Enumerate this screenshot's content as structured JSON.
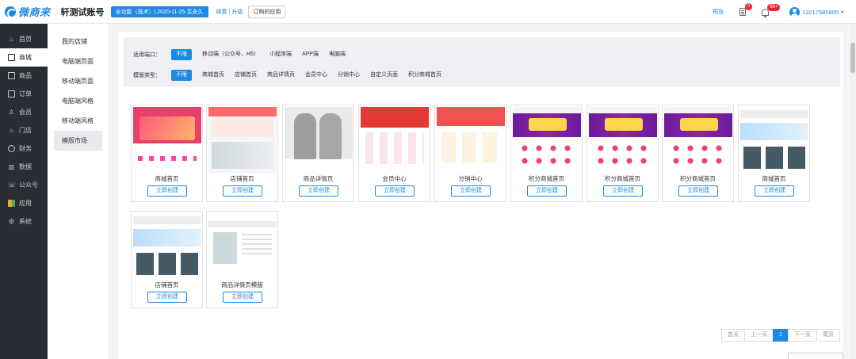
{
  "header": {
    "logo_text": "微商来",
    "account_name": "轩测试账号",
    "plan_badge": "全功能（技术）| 2020-11-25 至永久",
    "renew_label": "续费",
    "separator": "|",
    "upgrade_label": "升级",
    "ordered_apps_label": "订购的应用",
    "preview_label": "预览",
    "doc_badge_count": "0",
    "bell_badge_count": "99+",
    "phone": "13217585805"
  },
  "sidebar": {
    "items": [
      {
        "label": "首页",
        "icon": "home-icon"
      },
      {
        "label": "商城",
        "icon": "store-icon"
      },
      {
        "label": "商品",
        "icon": "goods-icon"
      },
      {
        "label": "订单",
        "icon": "order-icon"
      },
      {
        "label": "会员",
        "icon": "member-icon"
      },
      {
        "label": "门店",
        "icon": "shop-icon"
      },
      {
        "label": "财务",
        "icon": "finance-icon"
      },
      {
        "label": "数据",
        "icon": "data-icon"
      },
      {
        "label": "公众号",
        "icon": "wechat-icon"
      },
      {
        "label": "应用",
        "icon": "apps-icon"
      },
      {
        "label": "系统",
        "icon": "system-icon"
      }
    ],
    "active": "商城"
  },
  "subnav": {
    "items": [
      "我的店铺",
      "电脑端页面",
      "移动端页面",
      "电脑端风格",
      "移动端风格",
      "模版市场"
    ],
    "active": "模版市场"
  },
  "filters": {
    "port_label": "适用端口：",
    "port_options": [
      "不限",
      "移动端（公众号、H5）",
      "小程序端",
      "APP端",
      "电脑端"
    ],
    "type_label": "模版类型：",
    "type_options": [
      "不限",
      "商城首页",
      "店铺首页",
      "商品详情页",
      "会员中心",
      "分销中心",
      "自定义页面",
      "积分商城首页"
    ]
  },
  "templates": [
    {
      "title": "商城首页",
      "button": "立即创建"
    },
    {
      "title": "店铺首页",
      "button": "立即创建"
    },
    {
      "title": "商品详情页",
      "button": "立即创建"
    },
    {
      "title": "会员中心",
      "button": "立即创建"
    },
    {
      "title": "分销中心",
      "button": "立即创建"
    },
    {
      "title": "积分商城首页",
      "button": "立即创建"
    },
    {
      "title": "积分商城首页",
      "button": "立即创建"
    },
    {
      "title": "积分商城首页",
      "button": "立即创建"
    },
    {
      "title": "商城首页",
      "button": "立即创建"
    },
    {
      "title": "店铺首页",
      "button": "立即创建"
    },
    {
      "title": "商品详情页模版",
      "button": "立即创建"
    }
  ],
  "pagination": {
    "first": "首页",
    "prev": "上一页",
    "current": "1",
    "next": "下一页",
    "last": "尾页"
  },
  "colors": {
    "accent": "#1e88e5",
    "sidebar_bg": "#2a2d36",
    "badge_red": "#f5222d"
  }
}
